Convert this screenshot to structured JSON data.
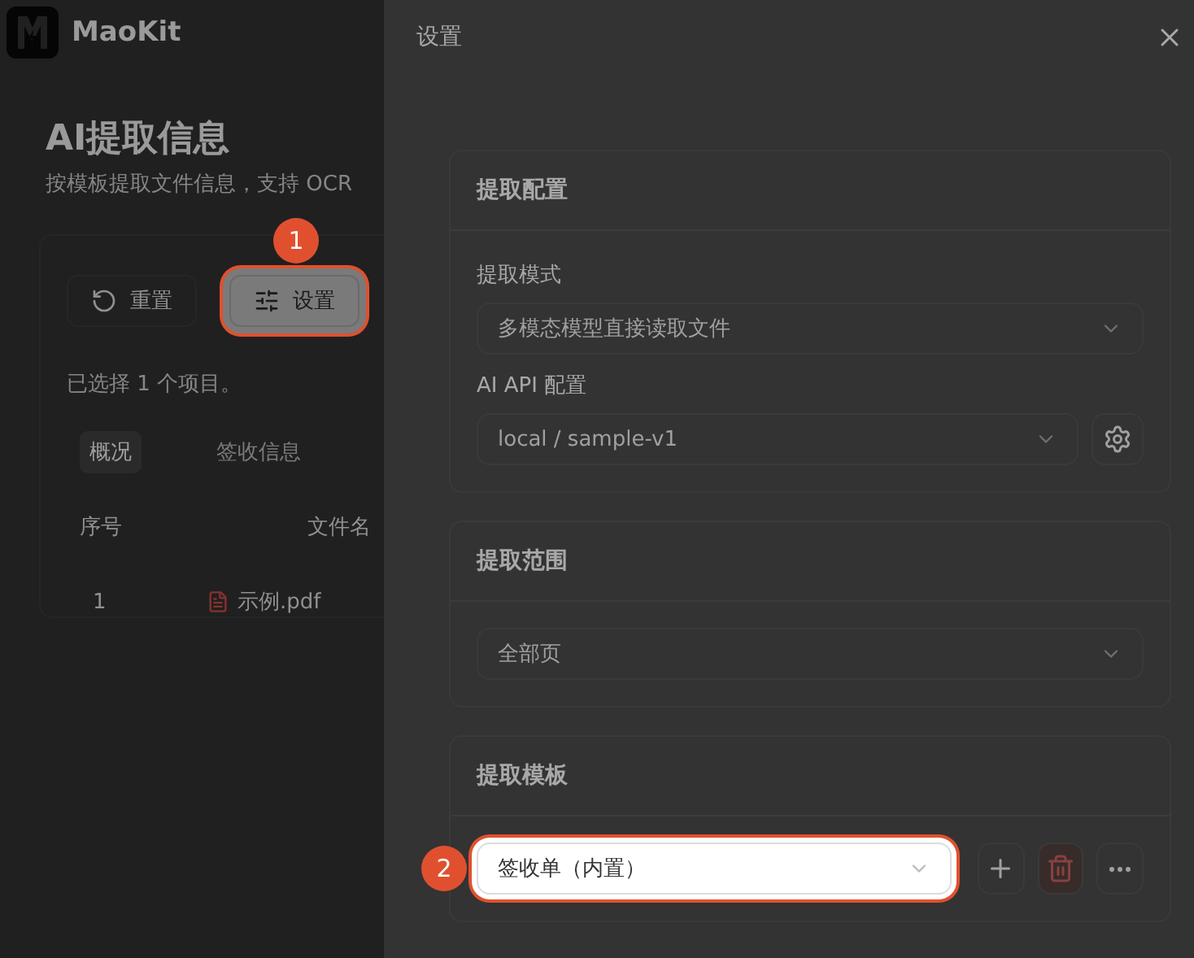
{
  "app": {
    "name": "MaoKit",
    "title": "AI提取信息",
    "subtitle": "按模板提取文件信息，支持 OCR",
    "toolbar": [
      {
        "kind": "reset",
        "label": "重置",
        "highlighted": false
      },
      {
        "kind": "settings",
        "label": "设置",
        "highlighted": true,
        "callout": "1"
      }
    ],
    "selection_note": "已选择 1 个项目。",
    "tabs": [
      {
        "label": "概况",
        "selected": true
      },
      {
        "label": "签收信息",
        "selected": false
      }
    ],
    "table": {
      "columns": [
        "序号",
        "文件名"
      ],
      "rows": [
        [
          "1",
          "示例.pdf"
        ]
      ]
    }
  },
  "drawer": {
    "title": "设置",
    "sections": [
      {
        "title": "提取配置",
        "fields": [
          {
            "label": "提取模式",
            "value": "多模态模型直接读取文件",
            "highlighted": false
          },
          {
            "label": "AI API 配置",
            "value": "local / sample-v1",
            "highlighted": false,
            "actions": [
              {
                "kind": "gear"
              }
            ]
          }
        ]
      },
      {
        "title": "提取范围",
        "fields": [
          {
            "value": "全部页",
            "highlighted": false
          }
        ]
      },
      {
        "title": "提取模板",
        "fields": [
          {
            "value": "签收单（内置）",
            "highlighted": true,
            "callout": "2",
            "actions": [
              {
                "kind": "add"
              },
              {
                "kind": "delete"
              },
              {
                "kind": "more"
              }
            ]
          }
        ]
      }
    ]
  }
}
